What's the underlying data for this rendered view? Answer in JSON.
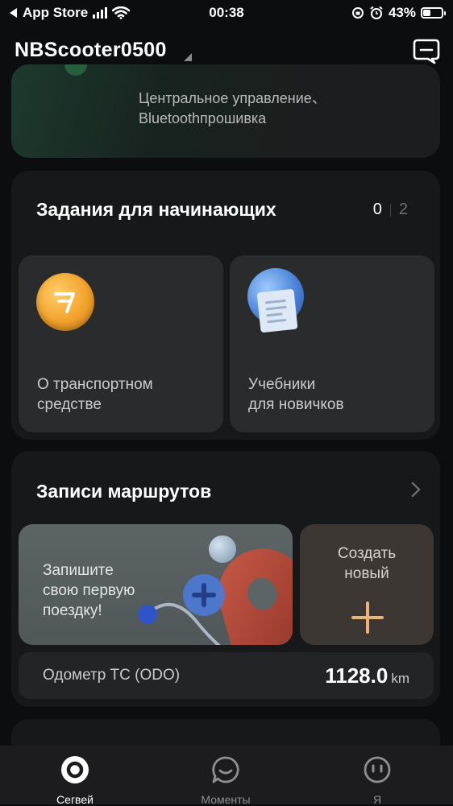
{
  "status_bar": {
    "back_app": "App Store",
    "time": "00:38",
    "battery_percent_text": "43%",
    "battery_level": 0.43
  },
  "header": {
    "device_name": "NBScooter0500"
  },
  "top_card": {
    "subtitle_line1": "Центральное управление、",
    "subtitle_line2": "Bluetoothпрошивка"
  },
  "beginner_tasks": {
    "title": "Задания для начинающих",
    "completed": "0",
    "total": "2",
    "items": [
      {
        "label_line1": "О транспортном",
        "label_line2": "средстве",
        "icon": "coin-icon"
      },
      {
        "label_line1": "Учебники",
        "label_line2": "для новичков",
        "icon": "tutorial-icon"
      }
    ]
  },
  "routes": {
    "title": "Записи маршрутов",
    "prompt_line1": "Запишите",
    "prompt_line2": "свою первую",
    "prompt_line3": "поездку!",
    "create_line1": "Создать",
    "create_line2": "новый",
    "odo_label": "Одометр ТС (ODO)",
    "odo_value": "1128.0",
    "odo_unit": "km"
  },
  "tabbar": {
    "tabs": [
      {
        "label": "Сегвей",
        "active": true
      },
      {
        "label": "Моменты",
        "active": false
      },
      {
        "label": "Я",
        "active": false
      }
    ]
  },
  "colors": {
    "background": "#0c0d0e",
    "card": "#17181a",
    "accent_orange": "#f2a22c",
    "create_plus": "#e8b27a"
  }
}
